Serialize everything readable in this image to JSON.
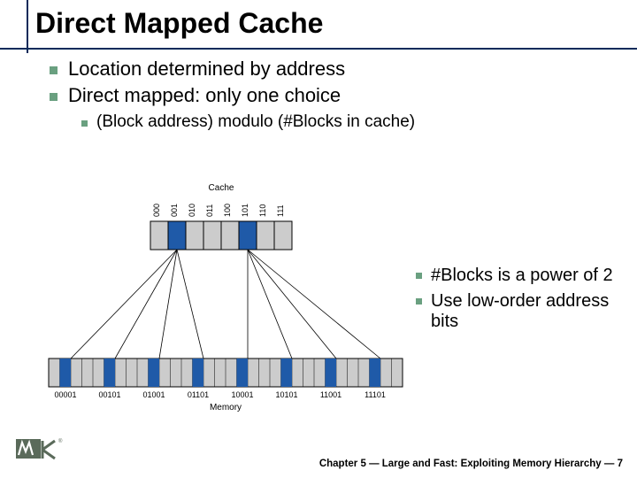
{
  "title": "Direct Mapped Cache",
  "bullets": {
    "b1": "Location determined by address",
    "b2": "Direct mapped: only one choice",
    "b2a": "(Block address) modulo (#Blocks in cache)"
  },
  "right": {
    "r1": "#Blocks is a power of 2",
    "r2": "Use low-order address bits"
  },
  "diagram": {
    "cache_title": "Cache",
    "memory_title": "Memory",
    "cache_labels": [
      "000",
      "001",
      "010",
      "011",
      "100",
      "101",
      "110",
      "111"
    ],
    "memory_labels": [
      "00001",
      "00101",
      "01001",
      "01101",
      "10001",
      "10101",
      "11001",
      "11101"
    ]
  },
  "footer": {
    "text": "Chapter 5 — Large and Fast: Exploiting Memory Hierarchy — 7"
  },
  "logo_alt": "MK"
}
